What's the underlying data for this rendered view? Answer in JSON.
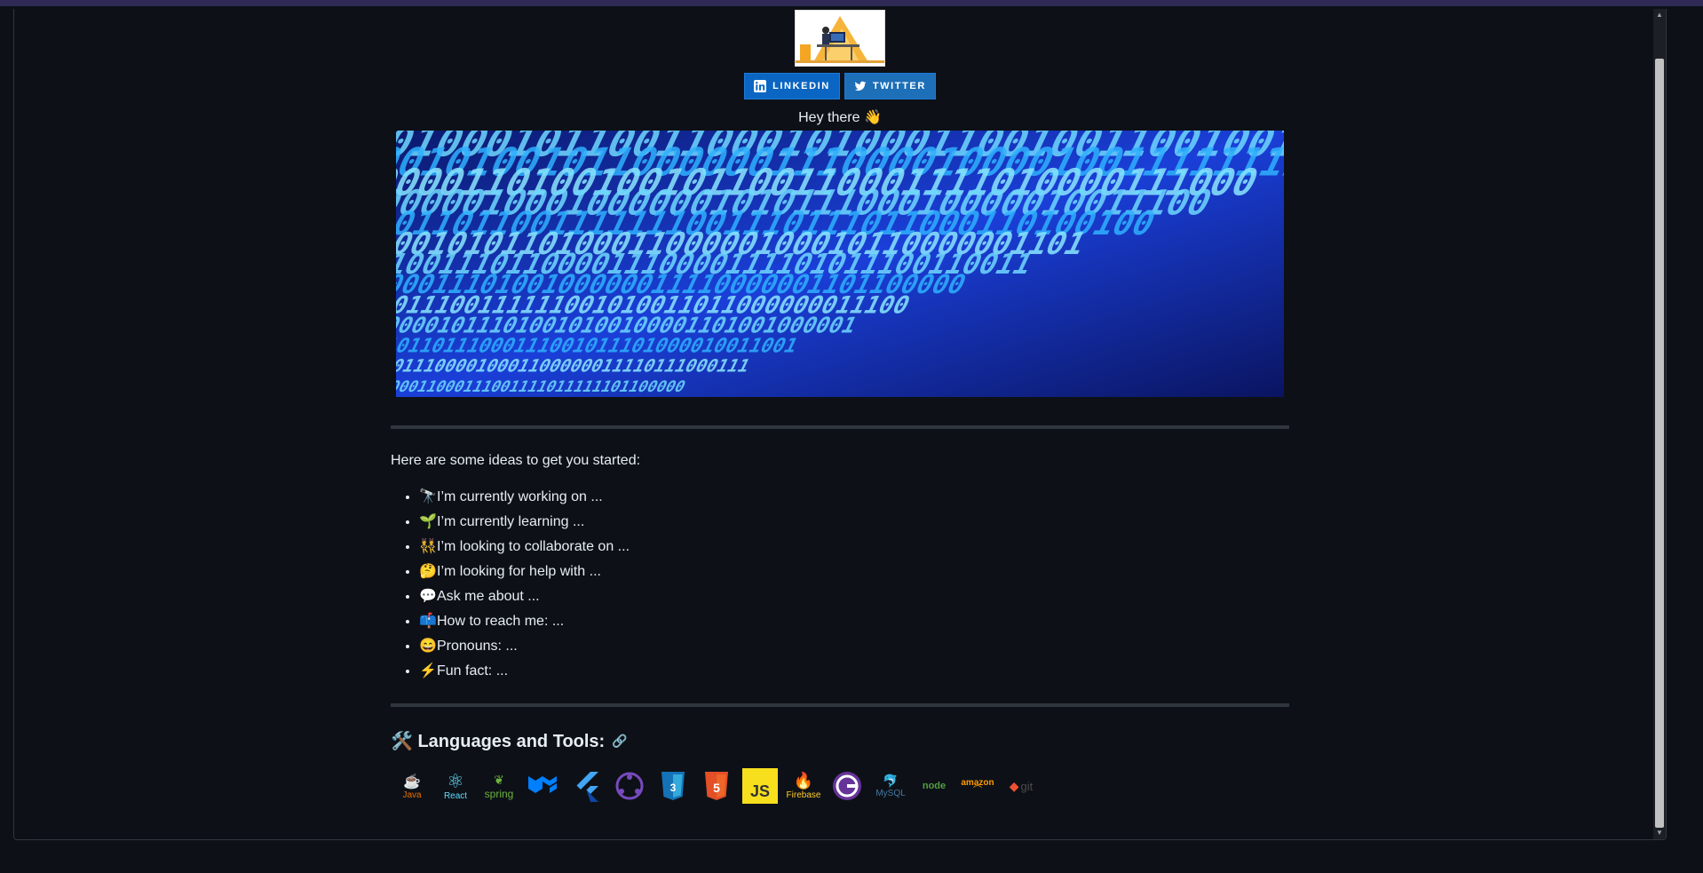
{
  "profile": {
    "badges": [
      {
        "label": "LINKEDIN",
        "icon": "linkedin-icon",
        "color": "#0a66c2"
      },
      {
        "label": "TWITTER",
        "icon": "twitter-icon",
        "color": "#1d6fb8"
      }
    ],
    "greeting": "Hey there 👋",
    "intro": "Here are some ideas to get you started:",
    "ideas": [
      {
        "emoji": "🔭",
        "text": "I’m currently working on ..."
      },
      {
        "emoji": "🌱",
        "text": "I’m currently learning ..."
      },
      {
        "emoji": "👯",
        "text": "I’m looking to collaborate on ..."
      },
      {
        "emoji": "🤔",
        "text": "I’m looking for help with ..."
      },
      {
        "emoji": "💬",
        "text": "Ask me about ..."
      },
      {
        "emoji": "📫",
        "text": "How to reach me: ..."
      },
      {
        "emoji": "😄",
        "text": "Pronouns: ..."
      },
      {
        "emoji": "⚡",
        "text": "Fun fact: ..."
      }
    ],
    "tools_title": "🛠️ Languages and Tools:",
    "tools": [
      {
        "label": "Java",
        "icon": "java-icon",
        "color": "#e76f00"
      },
      {
        "label": "React",
        "icon": "react-icon",
        "color": "#61dafb"
      },
      {
        "label": "spring",
        "icon": "spring-icon",
        "color": "#6db33f"
      },
      {
        "label": "",
        "icon": "material-ui-icon",
        "color": "#007fff"
      },
      {
        "label": "",
        "icon": "flutter-icon",
        "color": "#42a5f5"
      },
      {
        "label": "",
        "icon": "redux-icon",
        "color": "#764abc"
      },
      {
        "label": "",
        "icon": "css3-icon",
        "color": "#1572b6"
      },
      {
        "label": "5",
        "icon": "html5-icon",
        "color": "#e34f26"
      },
      {
        "label": "JS",
        "icon": "javascript-icon",
        "color": "#f7df1e"
      },
      {
        "label": "Firebase",
        "icon": "firebase-icon",
        "color": "#ffa000"
      },
      {
        "label": "",
        "icon": "gatsby-icon",
        "color": "#663399"
      },
      {
        "label": "MySQL",
        "icon": "mysql-icon",
        "color": "#4479a1"
      },
      {
        "label": "node",
        "icon": "nodejs-icon",
        "color": "#539e43"
      },
      {
        "label": "amazon",
        "icon": "aws-icon",
        "color": "#ff9900"
      },
      {
        "label": "git",
        "icon": "git-icon",
        "color": "#f05032"
      }
    ]
  }
}
